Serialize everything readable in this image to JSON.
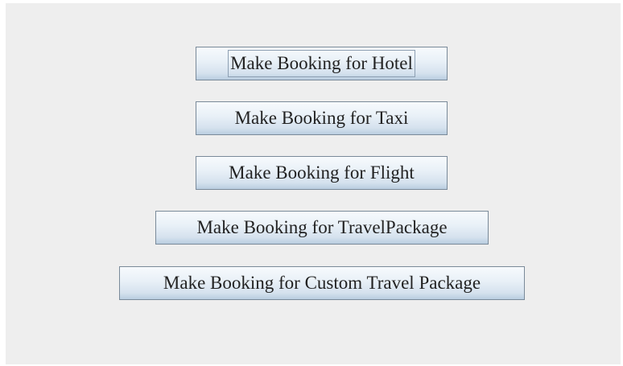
{
  "buttons": {
    "hotel": "Make Booking for Hotel",
    "taxi": "Make Booking for Taxi",
    "flight": "Make Booking for Flight",
    "travel_package": "Make Booking for TravelPackage",
    "custom_travel_package": "Make Booking for Custom Travel Package"
  },
  "focused_button": "hotel",
  "colors": {
    "panel_background": "#eeeeee",
    "button_border": "#7a8a99",
    "button_text": "#222222"
  }
}
